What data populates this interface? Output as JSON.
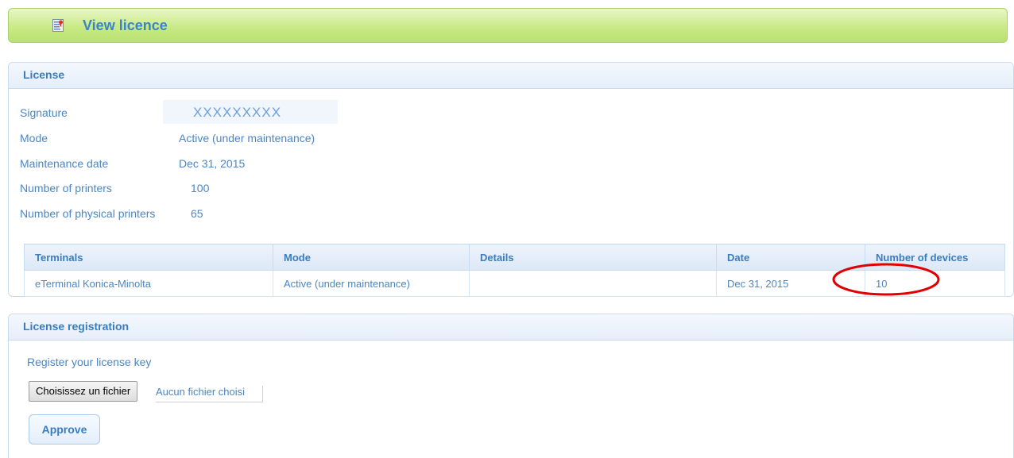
{
  "page": {
    "title": "View licence",
    "icon": "licence-document-icon"
  },
  "license_panel": {
    "title": "License",
    "fields": [
      {
        "label": "Signature",
        "value": "XXXXXXXXX"
      },
      {
        "label": "Mode",
        "value": "Active (under maintenance)"
      },
      {
        "label": "Maintenance date",
        "value": "Dec 31, 2015"
      },
      {
        "label": "Number of printers",
        "value": "100"
      },
      {
        "label": "Number of physical printers",
        "value": "65"
      }
    ],
    "table": {
      "headers": [
        "Terminals",
        "Mode",
        "Details",
        "Date",
        "Number of devices"
      ],
      "rows": [
        [
          "eTerminal Konica-Minolta",
          "Active (under maintenance)",
          "",
          "Dec 31, 2015",
          "10"
        ]
      ]
    }
  },
  "registration_panel": {
    "title": "License registration",
    "instruction": "Register your license key",
    "file_button_label": "Choisissez un fichier",
    "file_status": "Aucun fichier choisi",
    "approve_label": "Approve"
  },
  "colors": {
    "header_green": "#c9ea86",
    "title_blue": "#3a84c9",
    "text_blue": "#4d86c2",
    "annotation_red": "#e00000"
  }
}
